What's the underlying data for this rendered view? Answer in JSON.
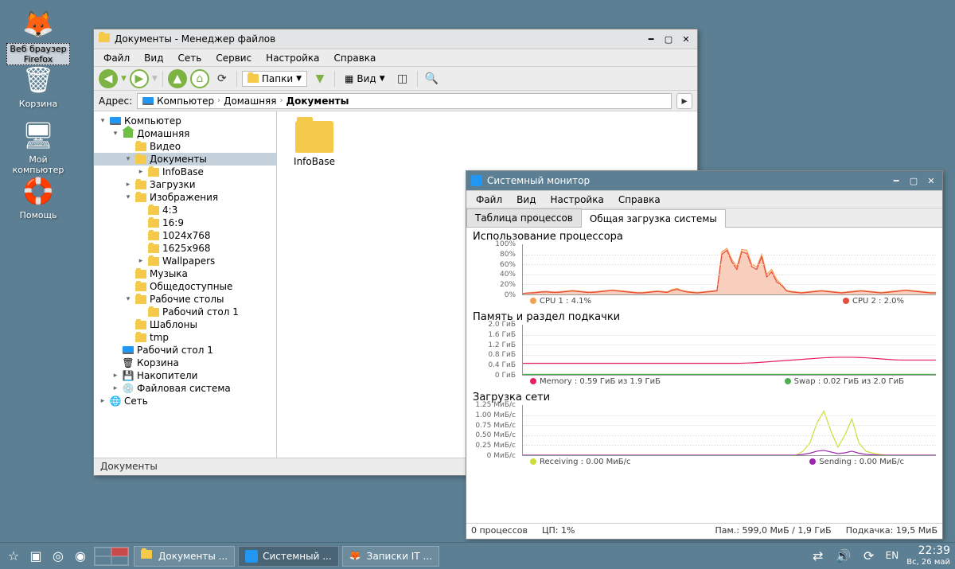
{
  "desktop": {
    "icons": [
      {
        "name": "firefox",
        "label": "Веб браузер\nFirefox",
        "selected": true
      },
      {
        "name": "trash",
        "label": "Корзина"
      },
      {
        "name": "computer",
        "label": "Мой\nкомпьютер"
      },
      {
        "name": "help",
        "label": "Помощь"
      }
    ]
  },
  "file_manager": {
    "title": "Документы - Менеджер файлов",
    "menu": [
      "Файл",
      "Вид",
      "Сеть",
      "Сервис",
      "Настройка",
      "Справка"
    ],
    "toolbar": {
      "folders_dd": "Папки",
      "view_dd": "Вид"
    },
    "address": {
      "label": "Адрес:",
      "crumbs": [
        "Компьютер",
        "Домашняя",
        "Документы"
      ]
    },
    "tree": [
      {
        "depth": 0,
        "exp": "▾",
        "icon": "pc",
        "label": "Компьютер"
      },
      {
        "depth": 1,
        "exp": "▾",
        "icon": "home",
        "label": "Домашняя"
      },
      {
        "depth": 2,
        "exp": "",
        "icon": "folder",
        "label": "Видео"
      },
      {
        "depth": 2,
        "exp": "▾",
        "icon": "folder",
        "label": "Документы",
        "sel": true
      },
      {
        "depth": 3,
        "exp": "▸",
        "icon": "folder",
        "label": "InfoBase"
      },
      {
        "depth": 2,
        "exp": "▸",
        "icon": "folder",
        "label": "Загрузки"
      },
      {
        "depth": 2,
        "exp": "▾",
        "icon": "folder",
        "label": "Изображения"
      },
      {
        "depth": 3,
        "exp": "",
        "icon": "folder",
        "label": "4:3"
      },
      {
        "depth": 3,
        "exp": "",
        "icon": "folder",
        "label": "16:9"
      },
      {
        "depth": 3,
        "exp": "",
        "icon": "folder",
        "label": "1024x768"
      },
      {
        "depth": 3,
        "exp": "",
        "icon": "folder",
        "label": "1625x968"
      },
      {
        "depth": 3,
        "exp": "▸",
        "icon": "folder",
        "label": "Wallpapers"
      },
      {
        "depth": 2,
        "exp": "",
        "icon": "folder",
        "label": "Музыка"
      },
      {
        "depth": 2,
        "exp": "",
        "icon": "folder",
        "label": "Общедоступные"
      },
      {
        "depth": 2,
        "exp": "▾",
        "icon": "folder",
        "label": "Рабочие столы"
      },
      {
        "depth": 3,
        "exp": "",
        "icon": "folder",
        "label": "Рабочий стол 1"
      },
      {
        "depth": 2,
        "exp": "",
        "icon": "folder",
        "label": "Шаблоны"
      },
      {
        "depth": 2,
        "exp": "",
        "icon": "folder",
        "label": "tmp"
      },
      {
        "depth": 1,
        "exp": "",
        "icon": "desk",
        "label": "Рабочий стол 1"
      },
      {
        "depth": 1,
        "exp": "",
        "icon": "trash",
        "label": "Корзина"
      },
      {
        "depth": 1,
        "exp": "▸",
        "icon": "drive",
        "label": "Накопители"
      },
      {
        "depth": 1,
        "exp": "▸",
        "icon": "fs",
        "label": "Файловая система"
      },
      {
        "depth": 0,
        "exp": "▸",
        "icon": "net",
        "label": "Сеть"
      }
    ],
    "content": [
      {
        "name": "InfoBase"
      }
    ],
    "status": "Документы"
  },
  "system_monitor": {
    "title": "Системный монитор",
    "menu": [
      "Файл",
      "Вид",
      "Настройка",
      "Справка"
    ],
    "tabs": [
      "Таблица процессов",
      "Общая загрузка системы"
    ],
    "active_tab": 1,
    "cpu": {
      "title": "Использование процессора",
      "legend": [
        {
          "c": "#f2a054",
          "t": "CPU 1 : 4.1%"
        },
        {
          "c": "#e74c3c",
          "t": "CPU 2 : 2.0%"
        }
      ]
    },
    "mem": {
      "title": "Память и раздел подкачки",
      "legend": [
        {
          "c": "#e91e63",
          "t": "Memory : 0.59 ГиБ из 1.9 ГиБ"
        },
        {
          "c": "#4caf50",
          "t": "Swap : 0.02 ГиБ из 2.0 ГиБ"
        }
      ]
    },
    "net": {
      "title": "Загрузка сети",
      "legend": [
        {
          "c": "#cddc39",
          "t": "Receiving : 0.00 МиБ/с"
        },
        {
          "c": "#9c27b0",
          "t": "Sending : 0.00 МиБ/с"
        }
      ]
    },
    "status": {
      "procs": "0 процессов",
      "cpu": "ЦП: 1%",
      "mem": "Пам.: 599,0 МиБ / 1,9 ГиБ",
      "swap": "Подкачка: 19,5 МиБ"
    }
  },
  "taskbar": {
    "buttons": [
      {
        "icon": "fm",
        "label": "Документы ...",
        "active": false
      },
      {
        "icon": "sm",
        "label": "Системный ...",
        "active": true
      },
      {
        "icon": "ff",
        "label": "Записки IT ...",
        "active": false
      }
    ],
    "lang": "EN",
    "time": "22:39",
    "date": "Вс, 26 май"
  },
  "chart_data": [
    {
      "type": "line",
      "title": "Использование процессора",
      "ylabel": "%",
      "ylim": [
        0,
        100
      ],
      "yticks": [
        "100%",
        "80%",
        "60%",
        "40%",
        "20%",
        "0%"
      ],
      "series": [
        {
          "name": "CPU 1",
          "color": "#f2a054",
          "values": [
            2,
            3,
            4,
            5,
            6,
            6,
            5,
            5,
            6,
            7,
            8,
            7,
            6,
            5,
            5,
            6,
            7,
            8,
            9,
            8,
            7,
            6,
            5,
            4,
            4,
            5,
            6,
            7,
            6,
            5,
            10,
            12,
            8,
            6,
            5,
            4,
            5,
            6,
            7,
            8,
            85,
            92,
            70,
            55,
            90,
            88,
            60,
            55,
            80,
            40,
            50,
            30,
            20,
            8,
            6,
            5,
            4,
            5,
            6,
            7,
            8,
            7,
            6,
            5,
            4,
            5,
            6,
            7,
            8,
            7,
            6,
            5,
            4,
            5,
            6,
            7,
            8,
            9,
            8,
            7,
            6,
            5,
            4,
            4
          ]
        },
        {
          "name": "CPU 2",
          "color": "#e74c3c",
          "values": [
            2,
            3,
            3,
            4,
            5,
            5,
            4,
            4,
            5,
            6,
            7,
            6,
            5,
            4,
            4,
            5,
            6,
            7,
            8,
            7,
            6,
            5,
            4,
            3,
            3,
            4,
            5,
            6,
            5,
            4,
            8,
            10,
            7,
            5,
            4,
            3,
            4,
            5,
            6,
            7,
            80,
            88,
            65,
            50,
            85,
            82,
            55,
            50,
            75,
            35,
            45,
            25,
            18,
            7,
            5,
            4,
            3,
            4,
            5,
            6,
            7,
            6,
            5,
            4,
            3,
            4,
            5,
            6,
            7,
            6,
            5,
            4,
            3,
            4,
            5,
            6,
            7,
            8,
            7,
            6,
            5,
            4,
            3,
            3
          ]
        }
      ]
    },
    {
      "type": "line",
      "title": "Память и раздел подкачки",
      "ylabel": "ГиБ",
      "ylim": [
        0,
        2.0
      ],
      "yticks": [
        "2.0 ГиБ",
        "1.6 ГиБ",
        "1.2 ГиБ",
        "0.8 ГиБ",
        "0.4 ГиБ",
        "0 ГиБ"
      ],
      "series": [
        {
          "name": "Memory",
          "color": "#e91e63",
          "values": [
            0.46,
            0.46,
            0.46,
            0.46,
            0.46,
            0.46,
            0.46,
            0.46,
            0.46,
            0.46,
            0.46,
            0.46,
            0.46,
            0.46,
            0.46,
            0.46,
            0.46,
            0.46,
            0.46,
            0.46,
            0.46,
            0.46,
            0.46,
            0.46,
            0.46,
            0.46,
            0.46,
            0.46,
            0.46,
            0.46,
            0.46,
            0.46,
            0.47,
            0.48,
            0.5,
            0.52,
            0.54,
            0.56,
            0.58,
            0.6,
            0.62,
            0.64,
            0.66,
            0.68,
            0.69,
            0.7,
            0.7,
            0.7,
            0.69,
            0.68,
            0.66,
            0.64,
            0.62,
            0.6,
            0.59,
            0.59,
            0.59,
            0.59,
            0.59,
            0.59
          ]
        },
        {
          "name": "Swap",
          "color": "#4caf50",
          "values": [
            0.02,
            0.02,
            0.02,
            0.02,
            0.02,
            0.02,
            0.02,
            0.02,
            0.02,
            0.02,
            0.02,
            0.02,
            0.02,
            0.02,
            0.02,
            0.02,
            0.02,
            0.02,
            0.02,
            0.02,
            0.02,
            0.02,
            0.02,
            0.02,
            0.02,
            0.02,
            0.02,
            0.02,
            0.02,
            0.02,
            0.02,
            0.02,
            0.02,
            0.02,
            0.02,
            0.02,
            0.02,
            0.02,
            0.02,
            0.02,
            0.02,
            0.02,
            0.02,
            0.02,
            0.02,
            0.02,
            0.02,
            0.02,
            0.02,
            0.02,
            0.02,
            0.02,
            0.02,
            0.02,
            0.02,
            0.02,
            0.02,
            0.02,
            0.02,
            0.02
          ]
        }
      ]
    },
    {
      "type": "line",
      "title": "Загрузка сети",
      "ylabel": "МиБ/с",
      "ylim": [
        0,
        1.25
      ],
      "yticks": [
        "1.25 МиБ/с",
        "1.00 МиБ/с",
        "0.75 МиБ/с",
        "0.50 МиБ/с",
        "0.25 МиБ/с",
        "0 МиБ/с"
      ],
      "series": [
        {
          "name": "Receiving",
          "color": "#cddc39",
          "values": [
            0,
            0,
            0,
            0,
            0,
            0,
            0,
            0,
            0,
            0,
            0,
            0,
            0,
            0,
            0,
            0,
            0,
            0,
            0,
            0,
            0,
            0,
            0,
            0,
            0,
            0,
            0,
            0,
            0,
            0,
            0,
            0,
            0,
            0,
            0,
            0,
            0,
            0,
            0,
            0,
            0.1,
            0.3,
            0.8,
            1.1,
            0.6,
            0.2,
            0.5,
            0.9,
            0.3,
            0.1,
            0.05,
            0.02,
            0,
            0,
            0,
            0,
            0,
            0,
            0,
            0
          ]
        },
        {
          "name": "Sending",
          "color": "#9c27b0",
          "values": [
            0,
            0,
            0,
            0,
            0,
            0,
            0,
            0,
            0,
            0,
            0,
            0,
            0,
            0,
            0,
            0,
            0,
            0,
            0,
            0,
            0,
            0,
            0,
            0,
            0,
            0,
            0,
            0,
            0,
            0,
            0,
            0,
            0,
            0,
            0,
            0,
            0,
            0,
            0,
            0,
            0.02,
            0.05,
            0.1,
            0.12,
            0.08,
            0.04,
            0.06,
            0.1,
            0.05,
            0.02,
            0.01,
            0,
            0,
            0,
            0,
            0,
            0,
            0,
            0,
            0
          ]
        }
      ]
    }
  ]
}
